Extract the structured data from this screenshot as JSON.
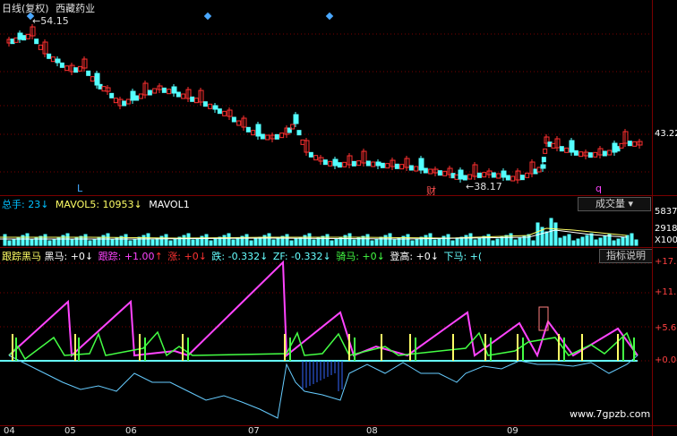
{
  "main": {
    "header": {
      "period": "日线(复权)",
      "name": "西藏药业"
    },
    "high_label": "54.15",
    "low_label": "38.17",
    "price_right": "43.22",
    "markers": [
      "L",
      "财",
      "q"
    ],
    "diamond_color": "#4aa8ff"
  },
  "volume": {
    "legend": [
      {
        "text": "总手: 23",
        "color": "#00c0ff"
      },
      {
        "text": "MAVOL5: 10953",
        "color": "#ffff66"
      },
      {
        "text": "MAVOL1",
        "color": "#ffffff"
      }
    ],
    "selector_label": "成交量",
    "scale": [
      "5837",
      "2918",
      "X100"
    ]
  },
  "indicator": {
    "legend": [
      {
        "text": "跟踪黑马",
        "color": "#ffff66"
      },
      {
        "text": "黑马: +0",
        "color": "#ffffff"
      },
      {
        "text": "跟踪: +1.00",
        "color": "#ff44ff"
      },
      {
        "text": "涨: +0",
        "color": "#ff3333"
      },
      {
        "text": "跌: -0.332",
        "color": "#66ffff"
      },
      {
        "text": "ZF: -0.332",
        "color": "#66ffff"
      },
      {
        "text": "骑马: +0",
        "color": "#44ff44"
      },
      {
        "text": "登高: +0",
        "color": "#ffffff"
      },
      {
        "text": "下马: +(",
        "color": "#66ffff"
      }
    ],
    "help_button": "指标说明",
    "scale": [
      "17.0",
      "11.3",
      "5.65",
      "0.04"
    ]
  },
  "x_axis": [
    "04",
    "05",
    "06",
    "07",
    "08",
    "09"
  ],
  "watermark": "www.7gpzb.com",
  "colors": {
    "up": "#ff3030",
    "down": "#54ffff",
    "grid": "#7a0000"
  }
}
